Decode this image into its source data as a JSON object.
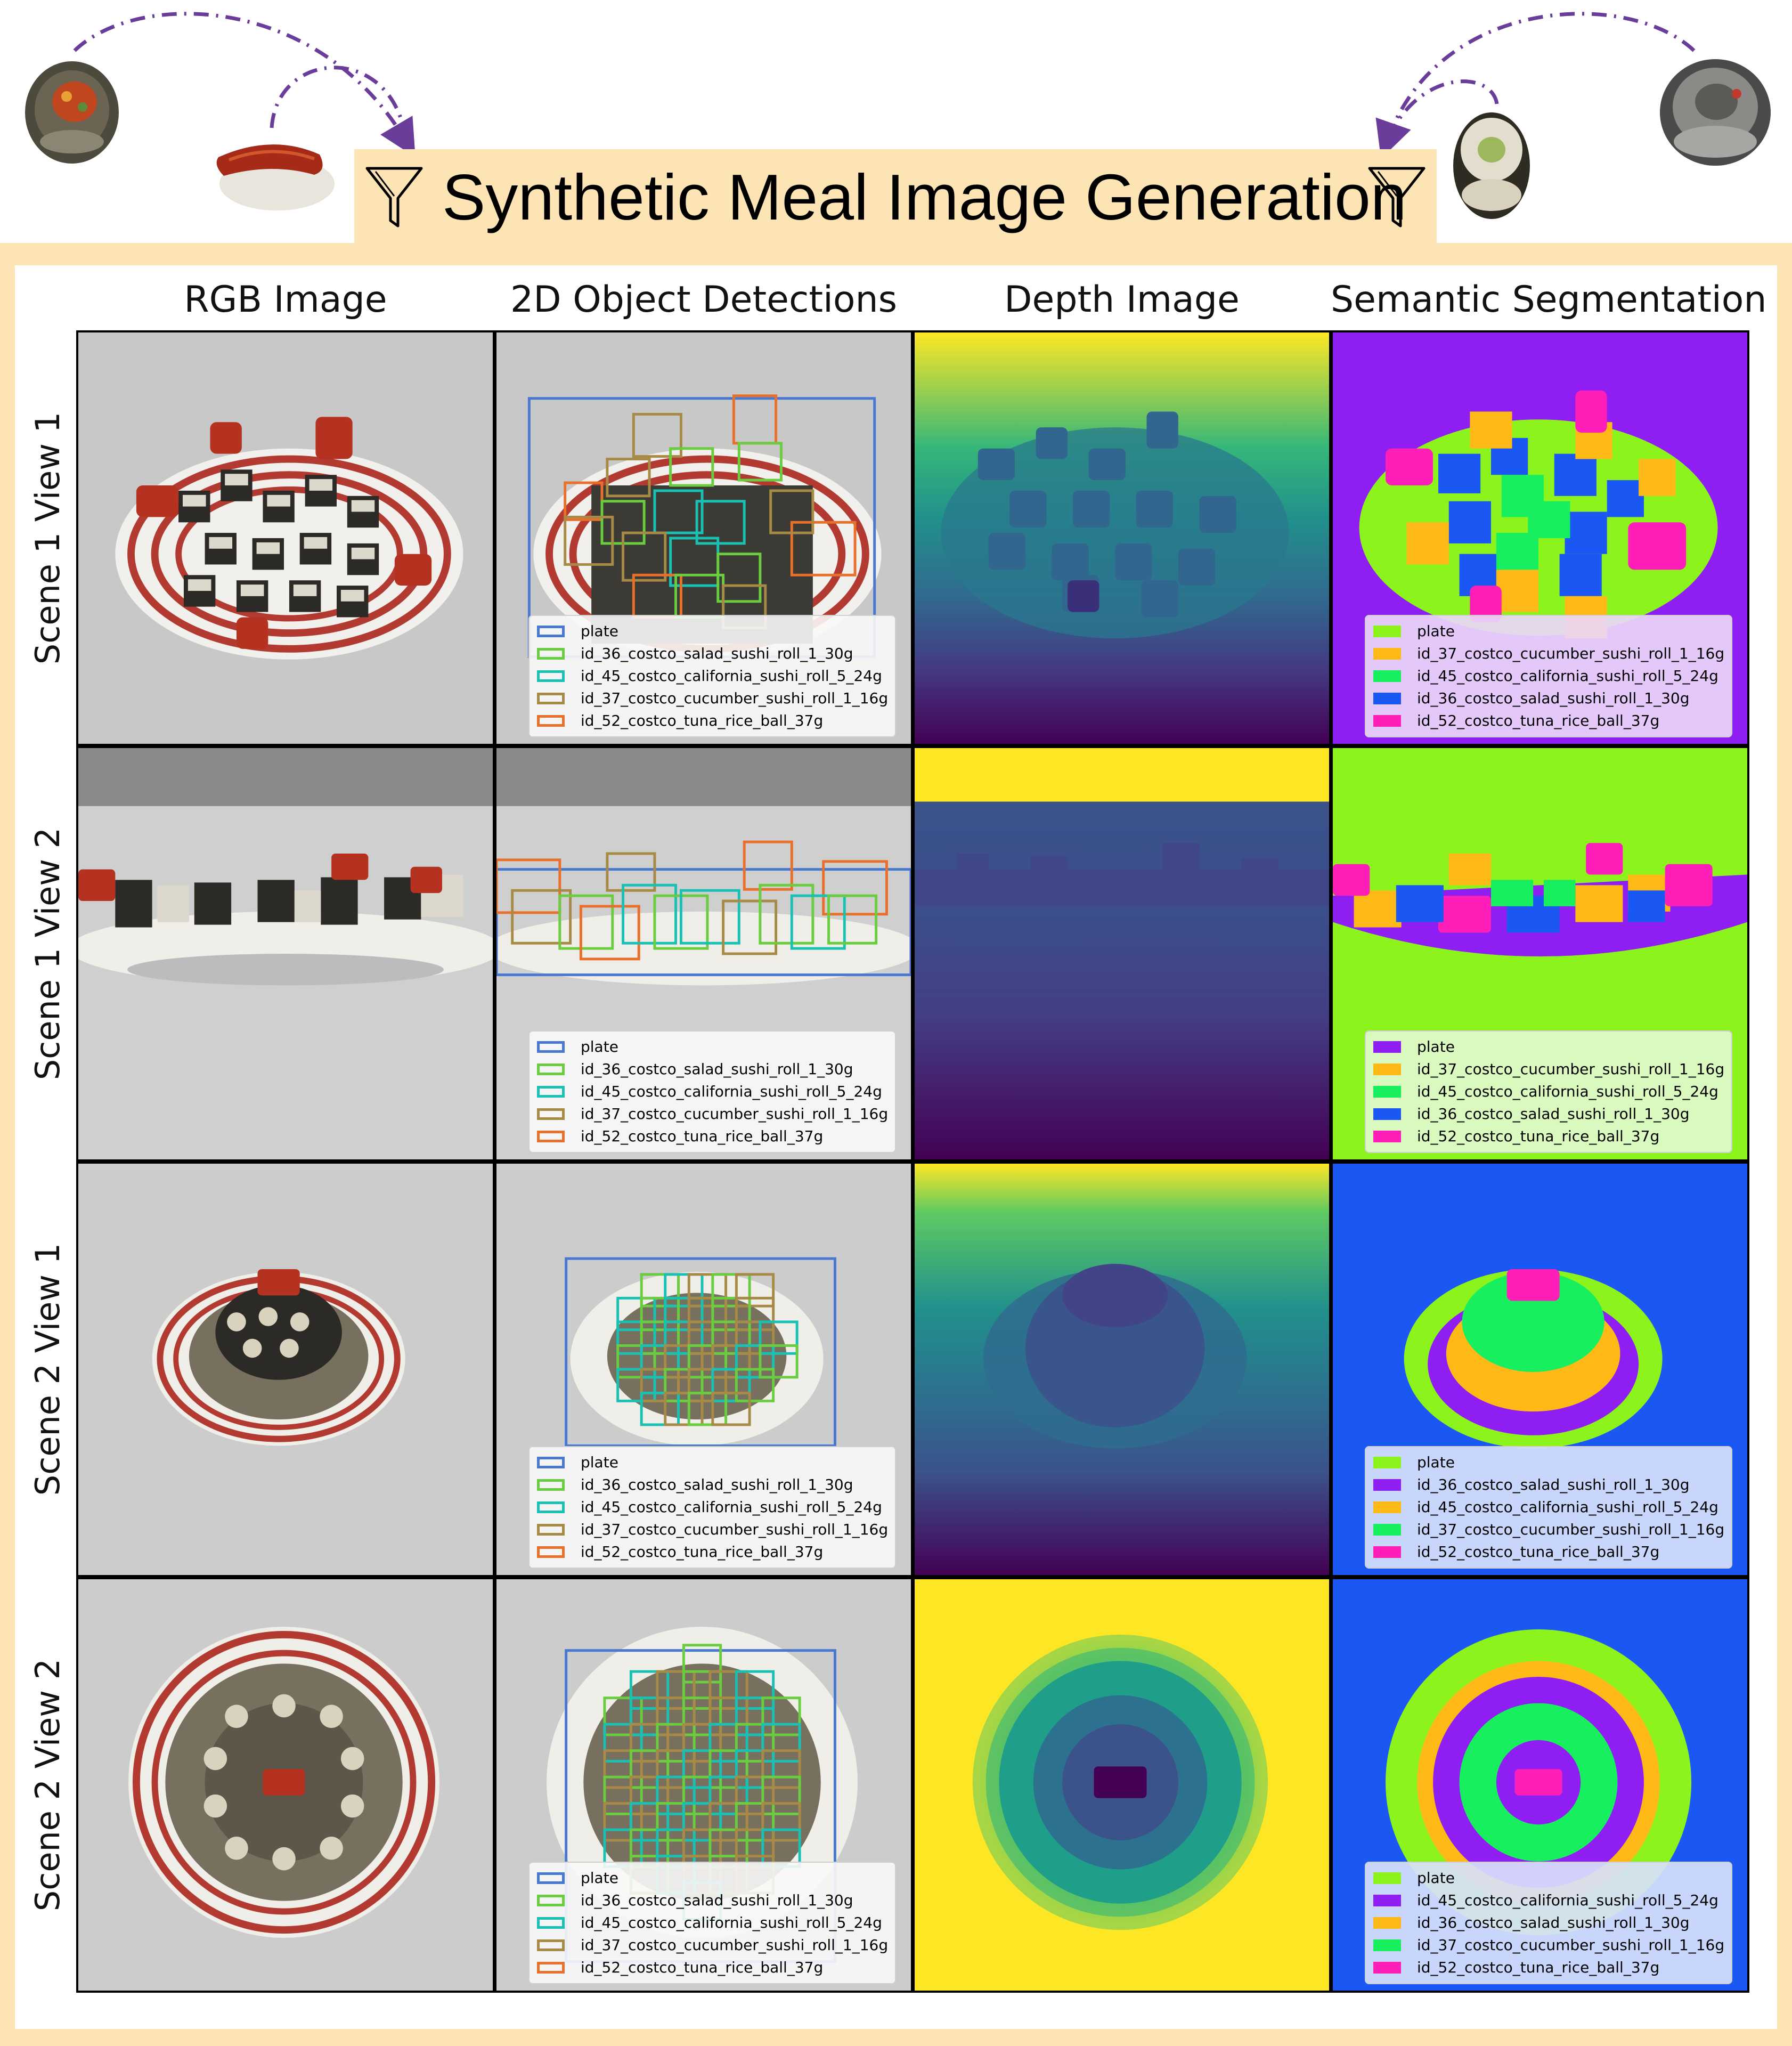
{
  "title": "Synthetic Meal Image Generation",
  "columns": [
    {
      "label": "RGB Image"
    },
    {
      "label": "2D Object Detections"
    },
    {
      "label": "Depth Image"
    },
    {
      "label": "Semantic Segmentation"
    }
  ],
  "rows": [
    {
      "label": "Scene 1 View 1"
    },
    {
      "label": "Scene 1 View 2"
    },
    {
      "label": "Scene 2 View 1"
    },
    {
      "label": "Scene 2 View 2"
    }
  ],
  "detection_legend": [
    {
      "label": "plate",
      "color": "#4878cf"
    },
    {
      "label": "id_36_costco_salad_sushi_roll_1_30g",
      "color": "#6acc3f"
    },
    {
      "label": "id_45_costco_california_sushi_roll_5_24g",
      "color": "#19c1b4"
    },
    {
      "label": "id_37_costco_cucumber_sushi_roll_1_16g",
      "color": "#a78a45"
    },
    {
      "label": "id_52_costco_tuna_rice_ball_37g",
      "color": "#e8702a"
    }
  ],
  "segmentation_legends": [
    [
      {
        "label": "plate",
        "color": "#8cf31c"
      },
      {
        "label": "id_37_costco_cucumber_sushi_roll_1_16g",
        "color": "#ffb917"
      },
      {
        "label": "id_45_costco_california_sushi_roll_5_24g",
        "color": "#17ef5e"
      },
      {
        "label": "id_36_costco_salad_sushi_roll_1_30g",
        "color": "#1b57f2"
      },
      {
        "label": "id_52_costco_tuna_rice_ball_37g",
        "color": "#ff1fb8"
      }
    ],
    [
      {
        "label": "plate",
        "color": "#8f1ef3"
      },
      {
        "label": "id_37_costco_cucumber_sushi_roll_1_16g",
        "color": "#ffb917"
      },
      {
        "label": "id_45_costco_california_sushi_roll_5_24g",
        "color": "#17ef5e"
      },
      {
        "label": "id_36_costco_salad_sushi_roll_1_30g",
        "color": "#1b57f2"
      },
      {
        "label": "id_52_costco_tuna_rice_ball_37g",
        "color": "#ff1fb8"
      }
    ],
    [
      {
        "label": "plate",
        "color": "#8cf31c"
      },
      {
        "label": "id_36_costco_salad_sushi_roll_1_30g",
        "color": "#8f1ef3"
      },
      {
        "label": "id_45_costco_california_sushi_roll_5_24g",
        "color": "#ffb917"
      },
      {
        "label": "id_37_costco_cucumber_sushi_roll_1_16g",
        "color": "#17ef5e"
      },
      {
        "label": "id_52_costco_tuna_rice_ball_37g",
        "color": "#ff1fb8"
      }
    ],
    [
      {
        "label": "plate",
        "color": "#8cf31c"
      },
      {
        "label": "id_45_costco_california_sushi_roll_5_24g",
        "color": "#8f1ef3"
      },
      {
        "label": "id_36_costco_salad_sushi_roll_1_30g",
        "color": "#ffb917"
      },
      {
        "label": "id_37_costco_cucumber_sushi_roll_1_16g",
        "color": "#17ef5e"
      },
      {
        "label": "id_52_costco_tuna_rice_ball_37g",
        "color": "#ff1fb8"
      }
    ]
  ],
  "colors": {
    "banner": "#fce4b5",
    "arrow": "#6a3d9a",
    "depth_near": "#440154",
    "depth_mid": "#21918c",
    "depth_far": "#fde725",
    "segmentation_background_blue": "#1b57f2"
  },
  "icons": [
    "funnel-icon",
    "sushi-model-icon",
    "dashed-arrow-icon"
  ]
}
